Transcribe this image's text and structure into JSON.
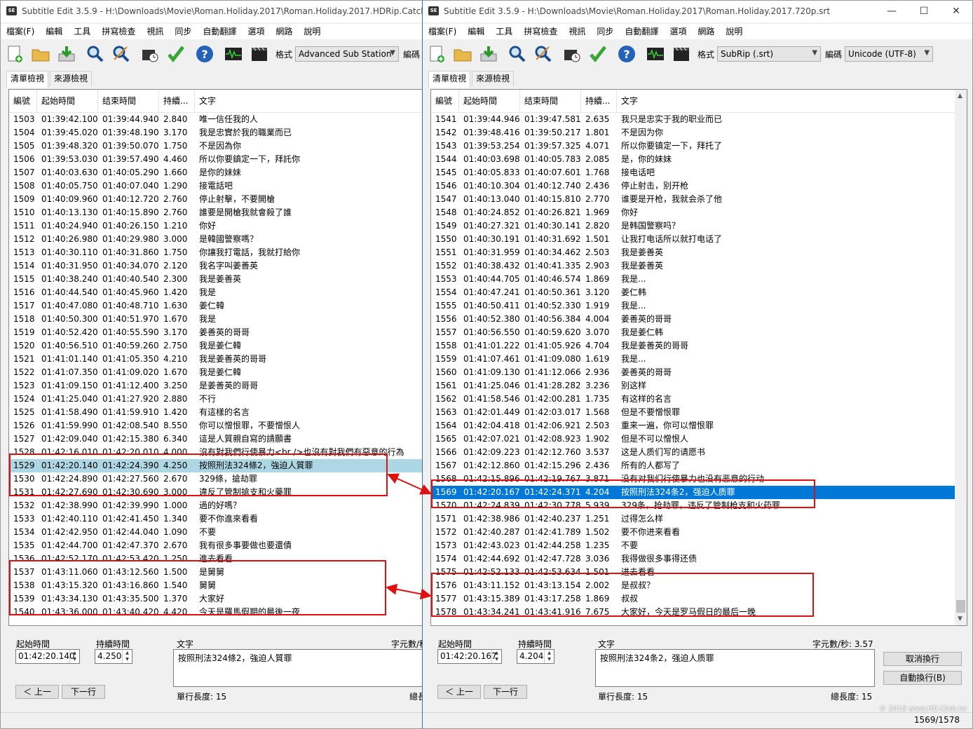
{
  "left_window": {
    "title": "Subtitle Edit 3.5.9 - H:\\Downloads\\Movie\\Roman.Holiday.2017\\Roman.Holiday.2017.HDRip.CatchPla",
    "menu": [
      "檔案(F)",
      "編輯",
      "工具",
      "拼寫檢查",
      "視訊",
      "同步",
      "自動翻譯",
      "選項",
      "網路",
      "說明"
    ],
    "format_label": "格式",
    "format_value": "Advanced Sub Station",
    "encoding_label": "編碼",
    "tabs": [
      "清單檢視",
      "來源檢視"
    ],
    "columns": [
      "編號",
      "起始時間",
      "结束時間",
      "持續...",
      "文字"
    ],
    "rows": [
      [
        "1503",
        "01:39:42.100",
        "01:39:44.940",
        "2.840",
        "唯一信任我的人"
      ],
      [
        "1504",
        "01:39:45.020",
        "01:39:48.190",
        "3.170",
        "我是忠實於我的職業而已"
      ],
      [
        "1505",
        "01:39:48.320",
        "01:39:50.070",
        "1.750",
        "不是因為你"
      ],
      [
        "1506",
        "01:39:53.030",
        "01:39:57.490",
        "4.460",
        "所以你要鎮定一下，拜託你"
      ],
      [
        "1507",
        "01:40:03.630",
        "01:40:05.290",
        "1.660",
        "是你的妹妹"
      ],
      [
        "1508",
        "01:40:05.750",
        "01:40:07.040",
        "1.290",
        "接電話吧"
      ],
      [
        "1509",
        "01:40:09.960",
        "01:40:12.720",
        "2.760",
        "停止射擊，不要開槍"
      ],
      [
        "1510",
        "01:40:13.130",
        "01:40:15.890",
        "2.760",
        "誰要是開槍我就會殺了誰"
      ],
      [
        "1511",
        "01:40:24.940",
        "01:40:26.150",
        "1.210",
        "你好"
      ],
      [
        "1512",
        "01:40:26.980",
        "01:40:29.980",
        "3.000",
        "是韓國警察嗎？"
      ],
      [
        "1513",
        "01:40:30.110",
        "01:40:31.860",
        "1.750",
        "你讓我打電話，我就打給你"
      ],
      [
        "1514",
        "01:40:31.950",
        "01:40:34.070",
        "2.120",
        "我名字叫姜善英"
      ],
      [
        "1515",
        "01:40:38.240",
        "01:40:40.540",
        "2.300",
        "我是姜善英"
      ],
      [
        "1516",
        "01:40:44.540",
        "01:40:45.960",
        "1.420",
        "我是"
      ],
      [
        "1517",
        "01:40:47.080",
        "01:40:48.710",
        "1.630",
        "姜仁韓"
      ],
      [
        "1518",
        "01:40:50.300",
        "01:40:51.970",
        "1.670",
        "我是"
      ],
      [
        "1519",
        "01:40:52.420",
        "01:40:55.590",
        "3.170",
        "姜善英的哥哥"
      ],
      [
        "1520",
        "01:40:56.510",
        "01:40:59.260",
        "2.750",
        "我是姜仁韓"
      ],
      [
        "1521",
        "01:41:01.140",
        "01:41:05.350",
        "4.210",
        "我是姜善英的哥哥"
      ],
      [
        "1522",
        "01:41:07.350",
        "01:41:09.020",
        "1.670",
        "我是姜仁韓"
      ],
      [
        "1523",
        "01:41:09.150",
        "01:41:12.400",
        "3.250",
        "是姜善英的哥哥"
      ],
      [
        "1524",
        "01:41:25.040",
        "01:41:27.920",
        "2.880",
        "不行"
      ],
      [
        "1525",
        "01:41:58.490",
        "01:41:59.910",
        "1.420",
        "有這樣的名言"
      ],
      [
        "1526",
        "01:41:59.990",
        "01:42:08.540",
        "8.550",
        "你可以憎恨罪，不要憎恨人"
      ],
      [
        "1527",
        "01:42:09.040",
        "01:42:15.380",
        "6.340",
        "這是人質親自寫的請願書"
      ],
      [
        "1528",
        "01:42:16.010",
        "01:42:20.010",
        "4.000",
        "沒有對我們行使暴力<br />也沒有對我們有惡意的行為"
      ],
      [
        "1529",
        "01:42:20.140",
        "01:42:24.390",
        "4.250",
        "按照刑法324條2，強迫人質罪"
      ],
      [
        "1530",
        "01:42:24.890",
        "01:42:27.560",
        "2.670",
        "329條，搶劫罪"
      ],
      [
        "1531",
        "01:42:27.690",
        "01:42:30.690",
        "3.000",
        "違反了管制搶支和火藥罪"
      ],
      [
        "1532",
        "01:42:38.990",
        "01:42:39.990",
        "1.000",
        "過的好嗎？"
      ],
      [
        "1533",
        "01:42:40.110",
        "01:42:41.450",
        "1.340",
        "要不你進來看看"
      ],
      [
        "1534",
        "01:42:42.950",
        "01:42:44.040",
        "1.090",
        "不要"
      ],
      [
        "1535",
        "01:42:44.700",
        "01:42:47.370",
        "2.670",
        "我有很多事要做也要還債"
      ],
      [
        "1536",
        "01:42:52.170",
        "01:42:53.420",
        "1.250",
        "進去看看"
      ],
      [
        "1537",
        "01:43:11.060",
        "01:43:12.560",
        "1.500",
        "是舅舅"
      ],
      [
        "1538",
        "01:43:15.320",
        "01:43:16.860",
        "1.540",
        "舅舅"
      ],
      [
        "1539",
        "01:43:34.130",
        "01:43:35.500",
        "1.370",
        "大家好"
      ],
      [
        "1540",
        "01:43:36.000",
        "01:43:40.420",
        "4.420",
        "今天是羅馬假期的最後一夜"
      ]
    ],
    "selected_row": "1529",
    "edit": {
      "start_label": "起始時間",
      "start_value": "01:42:20.140",
      "duration_label": "持續時間",
      "duration_value": "4.250",
      "text_label": "文字",
      "chars_label": "字元數/秒",
      "text_value": "按照刑法324條2，強迫人質罪",
      "prev_button": "＜ 上一",
      "next_button": "下一行",
      "single_line_length": "單行長度: 15",
      "total_length": "總長"
    }
  },
  "right_window": {
    "title": "Subtitle Edit 3.5.9 - H:\\Downloads\\Movie\\Roman.Holiday.2017\\Roman.Holiday.2017.720p.srt",
    "menu": [
      "檔案(F)",
      "編輯",
      "工具",
      "拼寫檢查",
      "視訊",
      "同步",
      "自動翻譯",
      "選項",
      "網路",
      "說明"
    ],
    "format_label": "格式",
    "format_value": "SubRip (.srt)",
    "encoding_label": "編碼",
    "encoding_value": "Unicode (UTF-8)",
    "tabs": [
      "清單檢視",
      "來源檢視"
    ],
    "columns": [
      "編號",
      "起始時間",
      "结束時間",
      "持續...",
      "文字"
    ],
    "rows": [
      [
        "1541",
        "01:39:44.946",
        "01:39:47.581",
        "2.635",
        "我只是忠实于我的职业而已"
      ],
      [
        "1542",
        "01:39:48.416",
        "01:39:50.217",
        "1.801",
        "不是因为你"
      ],
      [
        "1543",
        "01:39:53.254",
        "01:39:57.325",
        "4.071",
        "所以你要镇定一下，拜托了"
      ],
      [
        "1544",
        "01:40:03.698",
        "01:40:05.783",
        "2.085",
        "是，你的妹妹"
      ],
      [
        "1545",
        "01:40:05.833",
        "01:40:07.601",
        "1.768",
        "接电话吧"
      ],
      [
        "1546",
        "01:40:10.304",
        "01:40:12.740",
        "2.436",
        "停止射击，别开枪"
      ],
      [
        "1547",
        "01:40:13.040",
        "01:40:15.810",
        "2.770",
        "谁要是开枪，我就会杀了他"
      ],
      [
        "1548",
        "01:40:24.852",
        "01:40:26.821",
        "1.969",
        "你好"
      ],
      [
        "1549",
        "01:40:27.321",
        "01:40:30.141",
        "2.820",
        "是韩国警察吗？"
      ],
      [
        "1550",
        "01:40:30.191",
        "01:40:31.692",
        "1.501",
        "让我打电话所以就打电话了"
      ],
      [
        "1551",
        "01:40:31.959",
        "01:40:34.462",
        "2.503",
        "我是姜善英"
      ],
      [
        "1552",
        "01:40:38.432",
        "01:40:41.335",
        "2.903",
        "我是姜善英"
      ],
      [
        "1553",
        "01:40:44.705",
        "01:40:46.574",
        "1.869",
        "我是..."
      ],
      [
        "1554",
        "01:40:47.241",
        "01:40:50.361",
        "3.120",
        "姜仁韩"
      ],
      [
        "1555",
        "01:40:50.411",
        "01:40:52.330",
        "1.919",
        "我是..."
      ],
      [
        "1556",
        "01:40:52.380",
        "01:40:56.384",
        "4.004",
        "姜善英的哥哥"
      ],
      [
        "1557",
        "01:40:56.550",
        "01:40:59.620",
        "3.070",
        "我是姜仁韩"
      ],
      [
        "1558",
        "01:41:01.222",
        "01:41:05.926",
        "4.704",
        "我是姜善英的哥哥"
      ],
      [
        "1559",
        "01:41:07.461",
        "01:41:09.080",
        "1.619",
        "我是..."
      ],
      [
        "1560",
        "01:41:09.130",
        "01:41:12.066",
        "2.936",
        "姜善英的哥哥"
      ],
      [
        "1561",
        "01:41:25.046",
        "01:41:28.282",
        "3.236",
        "别这样"
      ],
      [
        "1562",
        "01:41:58.546",
        "01:42:00.281",
        "1.735",
        "有这样的名言"
      ],
      [
        "1563",
        "01:42:01.449",
        "01:42:03.017",
        "1.568",
        "但是不要憎恨罪"
      ],
      [
        "1564",
        "01:42:04.418",
        "01:42:06.921",
        "2.503",
        "重来一遍，你可以憎恨罪"
      ],
      [
        "1565",
        "01:42:07.021",
        "01:42:08.923",
        "1.902",
        "但是不可以憎恨人"
      ],
      [
        "1566",
        "01:42:09.223",
        "01:42:12.760",
        "3.537",
        "这是人质们写的请愿书"
      ],
      [
        "1567",
        "01:42:12.860",
        "01:42:15.296",
        "2.436",
        "所有的人都写了"
      ],
      [
        "1568",
        "01:42:15.896",
        "01:42:19.767",
        "3.871",
        "没有对我们行使暴力也没有恶意的行动"
      ],
      [
        "1569",
        "01:42:20.167",
        "01:42:24.371",
        "4.204",
        "按照刑法324条2，强迫人质罪"
      ],
      [
        "1570",
        "01:42:24.839",
        "01:42:30.778",
        "5.939",
        "329条，抢劫罪，违反了管制枪支和火药罪"
      ],
      [
        "1571",
        "01:42:38.986",
        "01:42:40.237",
        "1.251",
        "过得怎么样"
      ],
      [
        "1572",
        "01:42:40.287",
        "01:42:41.789",
        "1.502",
        "要不你进来看看"
      ],
      [
        "1573",
        "01:42:43.023",
        "01:42:44.258",
        "1.235",
        "不要"
      ],
      [
        "1574",
        "01:42:44.692",
        "01:42:47.728",
        "3.036",
        "我得做很多事得还债"
      ],
      [
        "1575",
        "01:42:52.133",
        "01:42:53.634",
        "1.501",
        "进去看看"
      ],
      [
        "1576",
        "01:43:11.152",
        "01:43:13.154",
        "2.002",
        "是叔叔？"
      ],
      [
        "1577",
        "01:43:15.389",
        "01:43:17.258",
        "1.869",
        "叔叔"
      ],
      [
        "1578",
        "01:43:34.241",
        "01:43:41.916",
        "7.675",
        "大家好，今天是罗马假日的最后一晚"
      ]
    ],
    "selected_row": "1569",
    "edit": {
      "start_label": "起始時間",
      "start_value": "01:42:20.167",
      "duration_label": "持續時間",
      "duration_value": "4.204",
      "text_label": "文字",
      "chars_label": "字元數/秒: 3.57",
      "text_value": "按照刑法324条2，强迫人质罪",
      "cancel_wrap_button": "取消換行",
      "auto_wrap_button": "自動換行(B)",
      "prev_button": "＜ 上一",
      "next_button": "下一行",
      "single_line_length": "單行長度: 15",
      "total_length": "總長度: 15"
    },
    "status_count": "1569/1578"
  },
  "watermark": "© 2018 www.HD.Club.tw",
  "colors": {
    "highlight_box": "#e01010",
    "selected_blue": "#0078d7",
    "selected_light": "#aed7e6"
  }
}
